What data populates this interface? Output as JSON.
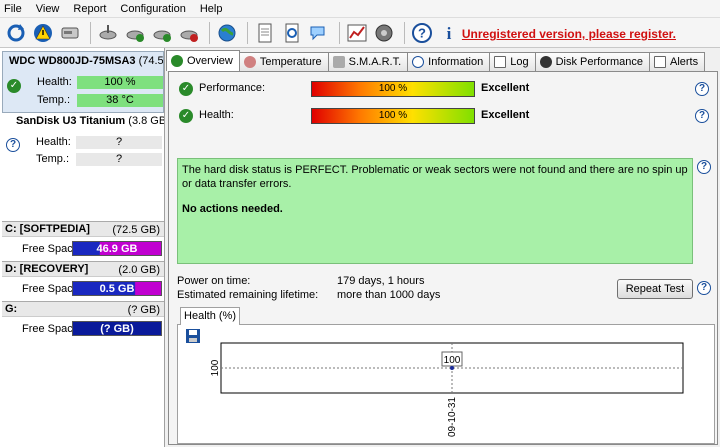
{
  "menu": [
    "File",
    "View",
    "Report",
    "Configuration",
    "Help"
  ],
  "toolbar": {
    "icons": [
      "refresh-icon",
      "warning-icon",
      "drive-icon",
      "satellite-icon",
      "satellite-ok-icon",
      "satellite-add-icon",
      "satellite-remove-icon",
      "globe-icon",
      "document-icon",
      "refresh-document-icon",
      "chat-icon",
      "chart-icon",
      "speaker-icon",
      "help-icon",
      "info-icon"
    ],
    "unregistered": "Unregistered version, please register."
  },
  "disks": [
    {
      "name": "WDC WD800JD-75MSA3",
      "size": "(74.5",
      "health_label": "Health:",
      "health": "100 %",
      "temp_label": "Temp.:",
      "temp": "38 °C"
    },
    {
      "name": "SanDisk U3 Titanium",
      "size": "(3.8 GB)",
      "health_label": "Health:",
      "health": "?",
      "temp_label": "Temp.:",
      "temp": "?"
    }
  ],
  "partitions": [
    {
      "name": "C: [SOFTPEDIA]",
      "size": "(72.5 GB)",
      "label": "Free Space",
      "value": "46.9 GB",
      "color": "#b000c8"
    },
    {
      "name": "D: [RECOVERY]",
      "size": "(2.0 GB)",
      "label": "Free Space",
      "value": "0.5 GB",
      "color": "#b000c8"
    },
    {
      "name": "G:",
      "size": "(? GB)",
      "label": "Free Space",
      "value": "(? GB)",
      "color": "#0a1a9a"
    }
  ],
  "tabs": [
    "Overview",
    "Temperature",
    "S.M.A.R.T.",
    "Information",
    "Log",
    "Disk Performance",
    "Alerts"
  ],
  "overview": {
    "performance_label": "Performance:",
    "performance_value": "100 %",
    "performance_rating": "Excellent",
    "health_label": "Health:",
    "health_value": "100 %",
    "health_rating": "Excellent",
    "status_text": "The hard disk status is PERFECT. Problematic or weak sectors were not found and there are no spin up or data transfer errors.",
    "action_text": "No actions needed.",
    "power_on_label": "Power on time:",
    "power_on_value": "179 days, 1 hours",
    "lifetime_label": "Estimated remaining lifetime:",
    "lifetime_value": "more than 1000 days",
    "repeat_button": "Repeat Test",
    "chart_tab": "Health (%)"
  },
  "chart_data": {
    "type": "line",
    "x": [
      "09-10-31"
    ],
    "series": [
      {
        "values": [
          100
        ]
      }
    ],
    "ytick": "100",
    "point_label": "100"
  },
  "colors": {
    "accent": "#d01010",
    "ok": "#2a8a2a"
  }
}
